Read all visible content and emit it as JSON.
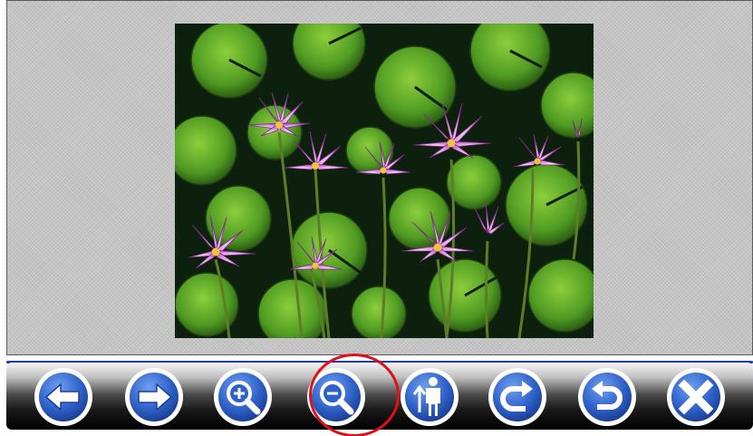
{
  "toolbar": {
    "buttons": [
      {
        "name": "previous-button",
        "icon": "arrow-left-icon"
      },
      {
        "name": "next-button",
        "icon": "arrow-right-icon"
      },
      {
        "name": "zoom-in-button",
        "icon": "zoom-in-icon"
      },
      {
        "name": "zoom-out-button",
        "icon": "zoom-out-icon"
      },
      {
        "name": "actual-size-button",
        "icon": "person-icon"
      },
      {
        "name": "rotate-clockwise-button",
        "icon": "rotate-right-icon"
      },
      {
        "name": "rotate-counterclockwise-button",
        "icon": "rotate-left-icon"
      },
      {
        "name": "close-button",
        "icon": "close-icon"
      }
    ]
  },
  "colors": {
    "button_fill": "#2f62c9",
    "button_ring": "#ffffff",
    "toolbar_accent": "#1e3fae",
    "highlight": "#e0101a"
  }
}
